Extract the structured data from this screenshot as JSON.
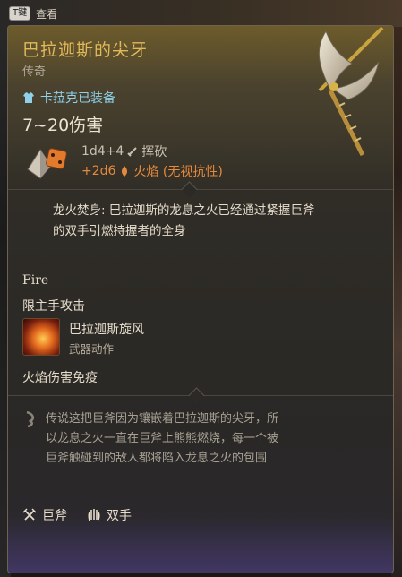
{
  "hotkey": {
    "key": "T键",
    "label": "查看"
  },
  "item": {
    "name": "巴拉迦斯的尖牙",
    "rarity": "传奇",
    "equipped_by": "卡菈克已装备",
    "damage_range": "7~20伤害",
    "damage": {
      "base_roll": "1d4+4",
      "base_type": "挥砍",
      "bonus_roll": "+2d6",
      "bonus_type": "火焰 (无视抗性)"
    },
    "passive": "龙火焚身: 巴拉迦斯的龙息之火已经通过紧握巨斧的双手引燃持握者的全身",
    "fire_tag": "Fire",
    "restriction": "限主手攻击",
    "action": {
      "name": "巴拉迦斯旋风",
      "type": "武器动作",
      "icon": "whirlwind-fire-icon"
    },
    "immunity": "火焰伤害免疫",
    "lore": "传说这把巨斧因为镶嵌着巴拉迦斯的尖牙，所以龙息之火一直在巨斧上熊熊燃烧，每一个被巨斧触碰到的敌人都将陷入龙息之火的包围",
    "footer": [
      {
        "icon": "greataxe-icon",
        "label": "巨斧"
      },
      {
        "icon": "two-hand-icon",
        "label": "双手"
      }
    ]
  },
  "colors": {
    "title": "#e2b95a",
    "equipped": "#8fd0ea",
    "fire": "#e58a3c",
    "lore": "#a9a294"
  }
}
